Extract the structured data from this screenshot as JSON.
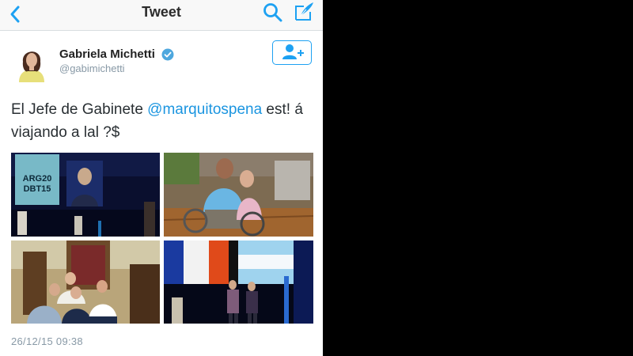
{
  "nav": {
    "title": "Tweet",
    "accent": "#1da1f2"
  },
  "author": {
    "name": "Gabriela Michetti",
    "handle": "@gabimichetti",
    "verified_icon": "verified-badge-icon"
  },
  "tweet": {
    "text_before": "El Jefe de Gabinete ",
    "mention": "@marquitospena",
    "text_after": " est! á viajando a lal ?$",
    "timestamp": "26/12/15 09:38"
  },
  "photos": [
    {
      "screen_text": "ARG20 DBT15"
    },
    {},
    {},
    {}
  ],
  "colors": {
    "link": "#1b95e0",
    "text": "#292f33",
    "muted": "#8899a6"
  }
}
